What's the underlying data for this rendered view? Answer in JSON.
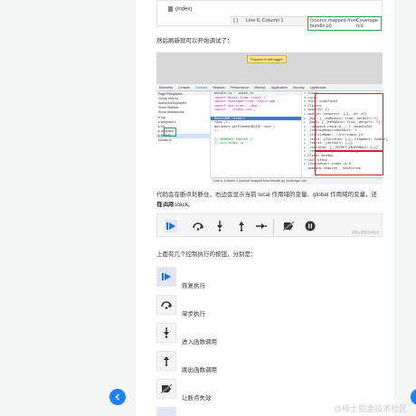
{
  "top_strip": {
    "file": "(index)",
    "braces": "{ }",
    "line_col": "Line 6, Column 1",
    "source_map": "(source mapped from bundle.js)",
    "coverage": "Coverage: n/a"
  },
  "text": {
    "p1": "然后刷新就可以开始调试了：",
    "p2_line1": "代码会在断点处断住，右边会显示当前 local 作用域的变量、global 作用域的变量，还有调用",
    "p2_line2": "栈 call stack。",
    "p3": "上面有几个控制执行的按钮，分别是："
  },
  "devtools": {
    "paused_label": "Paused in debugger",
    "tabs": [
      "Elements",
      "Console",
      "Sources",
      "Network",
      "Performance",
      "Memory",
      "Application",
      "Security",
      "Lighthouse"
    ],
    "active_tab": "Sources",
    "subtabs": [
      "Page",
      "Filesystem",
      "bundle.js",
      "index.js"
    ],
    "files": [
      "Group files by",
      "Authored/Deployed",
      "Show Sidebar",
      "Show breakpoints",
      "▾ top",
      "▸ webpack://",
      "▸ src",
      "▸ webpack",
      "▸ (index)",
      "bundle.js"
    ],
    "code": [
      "import React from 'react';",
      "import ReactDOM from 'react-dom';",
      "import App from './App';",
      "import './index.css';",
      "",
      "ReactDOM.render(",
      "  <App />,",
      "  document.getElementById('root')",
      ");",
      "",
      "// WEBPACK FOOTER //",
      "// src/index.js"
    ],
    "scope": [
      "▾ Scope",
      "▾ Local",
      "  ▸ this: undefined",
      "▾ Closure",
      "  ▸ exports: {}",
      "  ▸ module: {exports: {…}, id: 47}",
      "  ▸ _App: {__esModule: true, default: f}",
      "  ▸ _App2: {__esModule: true, default: f}",
      "  ▸ __webpack_require__: f (moduleId)",
      "  ▸ _interopRequireDefault: f",
      "  ▸ _jsxFileName: \"/src/index.js\"",
      "  ▸ _react: {Children: {…}, Fragment: Symbol}",
      "  ▸ _react2: {default: {…}}",
      "  ▸ _reactDom: {__SECRET_INTERNALS: {…}}",
      "  ▸ _reactDom2: {default: {…}}",
      "▸ Global  Window",
      "▾ Call Stack",
      "  ▸ (anonymous)  index.js:5",
      "  __webpack_require__  bootstrap"
    ],
    "status": "Line 6, Column 1   (source mapped from bundle.js)   Coverage: n/a"
  },
  "controls": {
    "watermark": "@稀土掘金技术社区",
    "items": [
      {
        "icon": "resume-icon",
        "label": "恢复执行"
      },
      {
        "icon": "step-over-icon",
        "label": "单步执行"
      },
      {
        "icon": "step-into-icon",
        "label": "进入函数调用"
      },
      {
        "icon": "step-out-icon",
        "label": "跳出函数调用"
      },
      {
        "icon": "deactivate-breakpoints-icon",
        "label": "让断点失效"
      }
    ]
  },
  "page_watermark": "@稀土掘金技术社区",
  "colors": {
    "accent": "#1e80ff",
    "resume_bg": "#dfe6f7",
    "red_box": "#e02020",
    "green_box": "#2ea44f"
  }
}
